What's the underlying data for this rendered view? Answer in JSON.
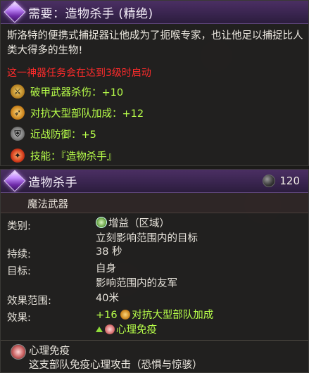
{
  "requirement": {
    "title": "需要：造物杀手 (精绝)",
    "description": "斯洛特的便携式捕捉器让他成为了扼喉专家，也让他足以捕捉比人类大得多的生物!",
    "warning": "这一神器任务会在达到3级时启动",
    "perks": [
      {
        "icon": "armor-piercing-icon",
        "text": "破甲武器杀伤：+10"
      },
      {
        "icon": "target-icon",
        "text": "对抗大型部队加成：+12"
      },
      {
        "icon": "shield-icon",
        "text": "近战防御：+5"
      },
      {
        "icon": "skill-icon",
        "text": "技能：『造物杀手』"
      }
    ]
  },
  "skill": {
    "title": "造物杀手",
    "cost": "120",
    "subtype": "魔法武器",
    "rows": {
      "type_label": "类别:",
      "type_value_1": "增益（区域）",
      "type_value_2": "立刻影响范围内的目标",
      "duration_label": "持续:",
      "duration_value": "38 秒",
      "target_label": "目标:",
      "target_value_1": "自身",
      "target_value_2": "影响范围内的友军",
      "range_label": "效果范围:",
      "range_value": "40米",
      "effect_label": "效果:",
      "effect_value_1": "+16",
      "effect_value_1b": "对抗大型部队加成",
      "effect_value_2": "心理免疫"
    },
    "immune": {
      "title": "心理免疫",
      "description": "这支部队免疫心理攻击（恐惧与惊骇）"
    }
  },
  "colors": {
    "header_purple": "#3a2550",
    "perk_green": "#b8ff4a",
    "warning_red": "#ff2b2b"
  }
}
